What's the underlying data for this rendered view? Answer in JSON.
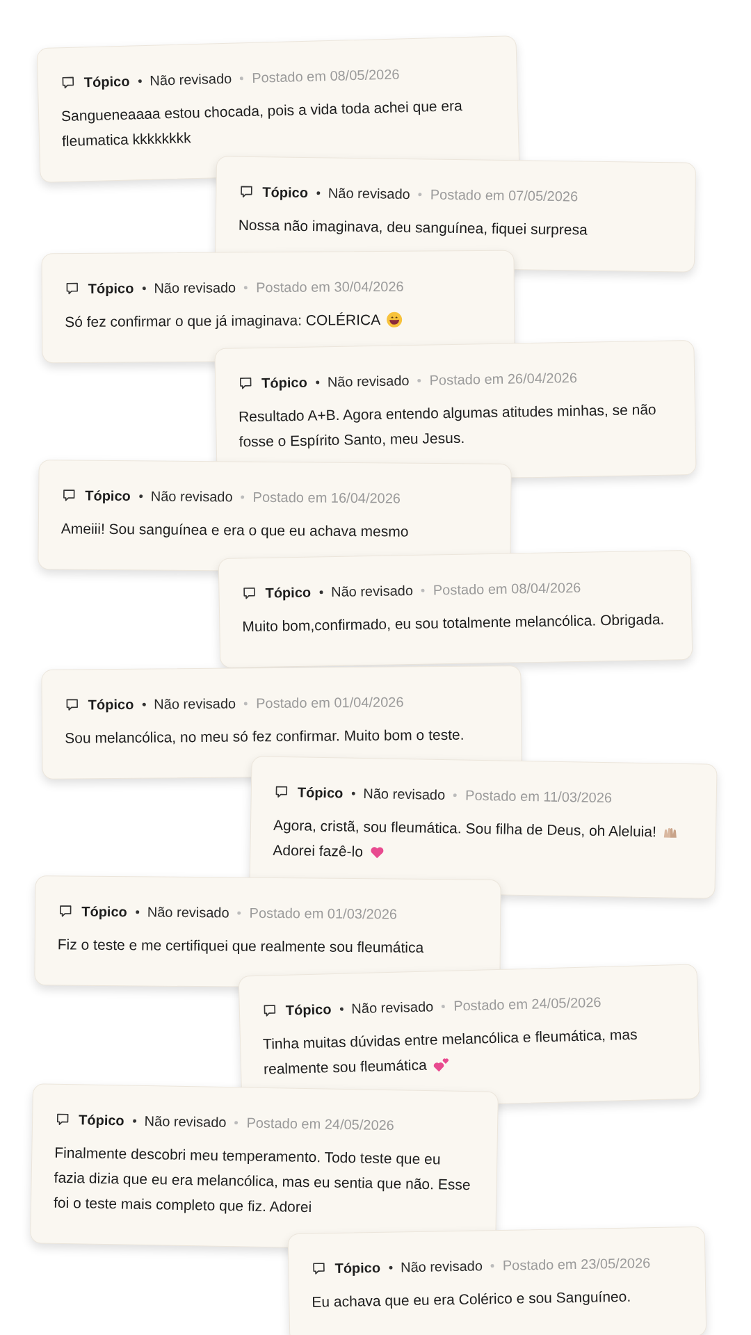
{
  "comments": [
    {
      "topic": "Tópico",
      "status": "Não revisado",
      "posted": "Postado em 08/05/2026",
      "lines": [
        [
          {
            "kind": "text",
            "text": "Sangueneaaaa estou chocada, pois a vida toda achei que era fleumatica kkkkkkkk"
          }
        ]
      ]
    },
    {
      "topic": "Tópico",
      "status": "Não revisado",
      "posted": "Postado em 07/05/2026",
      "lines": [
        [
          {
            "kind": "text",
            "text": "Nossa não imaginava, deu sanguínea, fiquei surpresa"
          }
        ]
      ]
    },
    {
      "topic": "Tópico",
      "status": "Não revisado",
      "posted": "Postado em 30/04/2026",
      "lines": [
        [
          {
            "kind": "text",
            "text": "Só fez confirmar o que já imaginava: COLÉRICA"
          },
          {
            "kind": "grin"
          }
        ]
      ]
    },
    {
      "topic": "Tópico",
      "status": "Não revisado",
      "posted": "Postado em 26/04/2026",
      "lines": [
        [
          {
            "kind": "text",
            "text": "Resultado A+B. Agora entendo algumas atitudes minhas, se não fosse o Espírito Santo, meu Jesus."
          }
        ]
      ]
    },
    {
      "topic": "Tópico",
      "status": "Não revisado",
      "posted": "Postado em 16/04/2026",
      "lines": [
        [
          {
            "kind": "text",
            "text": "Ameiii! Sou sanguínea e era o que eu achava mesmo"
          }
        ]
      ]
    },
    {
      "topic": "Tópico",
      "status": "Não revisado",
      "posted": "Postado em 08/04/2026",
      "lines": [
        [
          {
            "kind": "text",
            "text": "Muito bom,confirmado, eu sou totalmente melancólica. Obrigada."
          }
        ]
      ]
    },
    {
      "topic": "Tópico",
      "status": "Não revisado",
      "posted": "Postado em 01/04/2026",
      "lines": [
        [
          {
            "kind": "text",
            "text": "Sou melancólica, no meu só fez confirmar. Muito bom o teste."
          }
        ]
      ]
    },
    {
      "topic": "Tópico",
      "status": "Não revisado",
      "posted": "Postado em 11/03/2026",
      "lines": [
        [
          {
            "kind": "text",
            "text": "Agora, cristã, sou fleumática. Sou filha de Deus, oh Aleluia!"
          },
          {
            "kind": "hands"
          }
        ],
        [
          {
            "kind": "text",
            "text": "Adorei fazê-lo"
          },
          {
            "kind": "heart"
          }
        ]
      ]
    },
    {
      "topic": "Tópico",
      "status": "Não revisado",
      "posted": "Postado em 01/03/2026",
      "lines": [
        [
          {
            "kind": "text",
            "text": "Fiz o teste e me certifiquei que realmente sou fleumática"
          }
        ]
      ]
    },
    {
      "topic": "Tópico",
      "status": "Não revisado",
      "posted": "Postado em 24/05/2026",
      "lines": [
        [
          {
            "kind": "text",
            "text": "Tinha muitas dúvidas entre melancólica e fleumática, mas"
          }
        ],
        [
          {
            "kind": "text",
            "text": "realmente sou fleumática"
          },
          {
            "kind": "hearts"
          }
        ]
      ]
    },
    {
      "topic": "Tópico",
      "status": "Não revisado",
      "posted": "Postado em 24/05/2026",
      "lines": [
        [
          {
            "kind": "text",
            "text": "Finalmente descobri meu temperamento. Todo teste que eu fazia dizia que eu era melancólica, mas eu sentia que não. Esse foi o teste mais completo que fiz. Adorei"
          }
        ]
      ]
    },
    {
      "topic": "Tópico",
      "status": "Não revisado",
      "posted": "Postado em 23/05/2026",
      "lines": [
        [
          {
            "kind": "text",
            "text": "Eu achava que eu era Colérico e sou Sanguíneo."
          }
        ]
      ]
    }
  ]
}
